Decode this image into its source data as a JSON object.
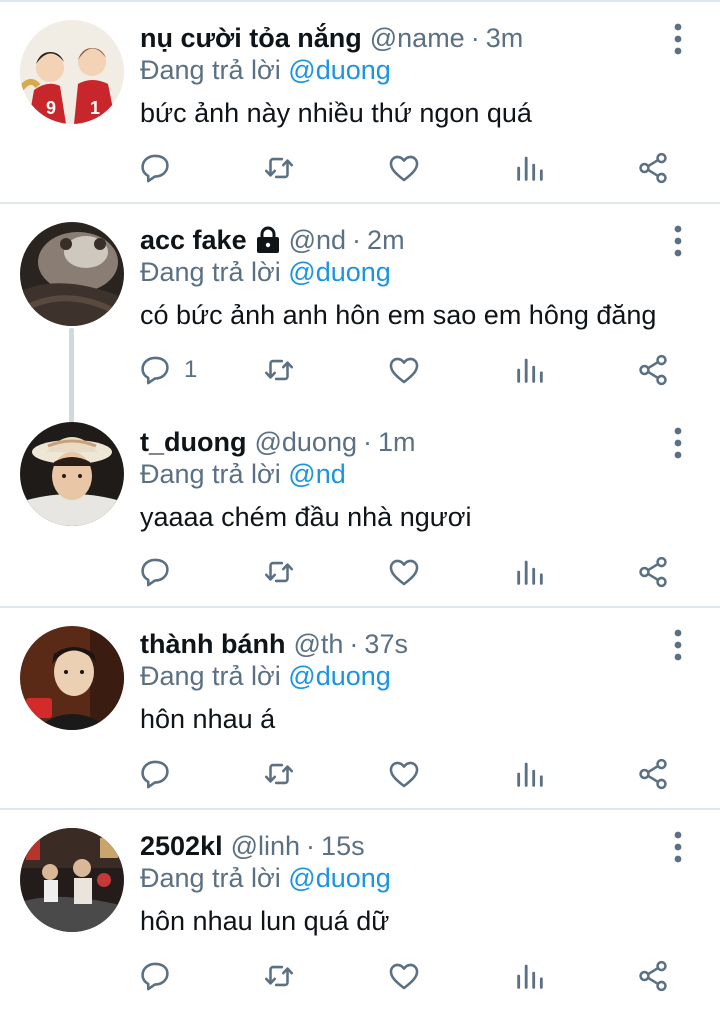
{
  "reply_prefix": "Đang trả lời",
  "icons": {
    "reply": "reply-icon",
    "retweet": "retweet-icon",
    "like": "like-icon",
    "stats": "analytics-icon",
    "share": "share-icon",
    "more": "more-options-icon",
    "lock": "lock-icon"
  },
  "colors": {
    "text_primary": "#0f1419",
    "text_secondary": "#5b7083",
    "mention": "#1b95e0",
    "divider": "#e1e8ed",
    "thread_line": "#cfd9de"
  },
  "tweets": [
    {
      "name": "nụ cười tỏa nắng",
      "handle": "@name",
      "dot": "·",
      "time": "3m",
      "reply_to": "@duong",
      "text": "bức ảnh này nhiều thứ ngon quá",
      "reply_count": "",
      "protected": false
    },
    {
      "name": "acc fake",
      "handle": "@nd",
      "dot": "·",
      "time": "2m",
      "reply_to": "@duong",
      "text": "có bức ảnh anh hôn em sao em hông đăng",
      "reply_count": "1",
      "protected": true
    },
    {
      "name": "t_duong",
      "handle": "@duong",
      "dot": "·",
      "time": "1m",
      "reply_to": "@nd",
      "text": "yaaaa chém đầu nhà ngươi",
      "reply_count": "",
      "protected": false
    },
    {
      "name": "thành bánh",
      "handle": "@th",
      "dot": "·",
      "time": "37s",
      "reply_to": "@duong",
      "text": "hôn nhau á",
      "reply_count": "",
      "protected": false
    },
    {
      "name": "2502kl",
      "handle": "@linh",
      "dot": "·",
      "time": "15s",
      "reply_to": "@duong",
      "text": "hôn nhau lun quá dữ",
      "reply_count": "",
      "protected": false
    }
  ]
}
